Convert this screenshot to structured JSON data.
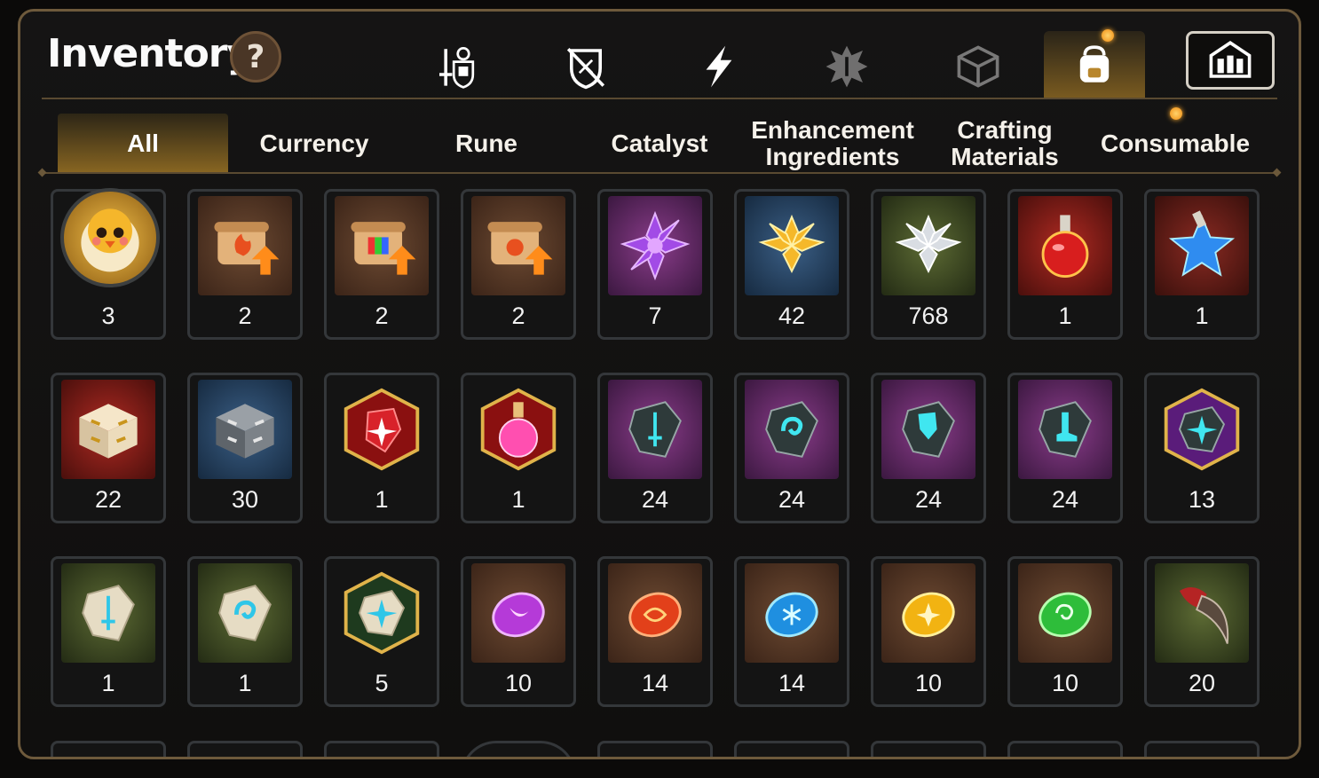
{
  "header": {
    "title": "Inventory",
    "help_label": "?"
  },
  "top_tabs": [
    {
      "name": "equipment-icon",
      "active": false
    },
    {
      "name": "no-gear-shield-icon",
      "active": false
    },
    {
      "name": "lightning-icon",
      "active": false
    },
    {
      "name": "spiky-emblem-icon",
      "active": false
    },
    {
      "name": "cube-icon",
      "active": false
    },
    {
      "name": "backpack-icon",
      "active": true
    },
    {
      "name": "castle-crest-icon",
      "active": false
    }
  ],
  "tabs": [
    {
      "label": "All",
      "active": true
    },
    {
      "label": "Currency"
    },
    {
      "label": "Rune"
    },
    {
      "label": "Catalyst"
    },
    {
      "label": "Enhancement Ingredients"
    },
    {
      "label": "Crafting Materials"
    },
    {
      "label": "Consumable"
    }
  ],
  "rows": [
    {
      "items": [
        {
          "icon": "chick-mascot-icon",
          "count": "3"
        },
        {
          "icon": "fire-scroll-upgrade-icon",
          "count": "2"
        },
        {
          "icon": "rainbow-scroll-upgrade-icon",
          "count": "2"
        },
        {
          "icon": "bag-scroll-upgrade-icon",
          "count": "2"
        },
        {
          "icon": "purple-crystal-flower-icon",
          "count": "7"
        },
        {
          "icon": "gold-crystal-flower-icon",
          "count": "42"
        },
        {
          "icon": "silver-crystal-flower-icon",
          "count": "768"
        },
        {
          "icon": "red-potion-flask-icon",
          "count": "1"
        },
        {
          "icon": "blue-star-potion-icon",
          "count": "1"
        }
      ]
    },
    {
      "items": [
        {
          "icon": "gold-treasure-chest-icon",
          "count": "22"
        },
        {
          "icon": "silver-treasure-chest-icon",
          "count": "30"
        },
        {
          "icon": "red-shard-hexagon-icon",
          "count": "1"
        },
        {
          "icon": "pink-potion-hexagon-icon",
          "count": "1"
        },
        {
          "icon": "sword-rune-stone-icon",
          "count": "24"
        },
        {
          "icon": "spiral-rune-stone-icon",
          "count": "24"
        },
        {
          "icon": "armor-rune-stone-icon",
          "count": "24"
        },
        {
          "icon": "boot-rune-stone-icon",
          "count": "24"
        },
        {
          "icon": "star-rune-hexagon-icon",
          "count": "13"
        }
      ]
    },
    {
      "items": [
        {
          "icon": "sword-rune-tablet-icon",
          "count": "1"
        },
        {
          "icon": "spiral-rune-tablet-icon",
          "count": "1"
        },
        {
          "icon": "star-rune-tablet-hexagon-icon",
          "count": "5"
        },
        {
          "icon": "moon-gem-icon",
          "count": "10"
        },
        {
          "icon": "fire-gem-icon",
          "count": "14"
        },
        {
          "icon": "snowflake-gem-icon",
          "count": "14"
        },
        {
          "icon": "sun-gem-icon",
          "count": "10"
        },
        {
          "icon": "wind-gem-icon",
          "count": "10"
        },
        {
          "icon": "beast-claw-icon",
          "count": "20"
        }
      ]
    }
  ]
}
